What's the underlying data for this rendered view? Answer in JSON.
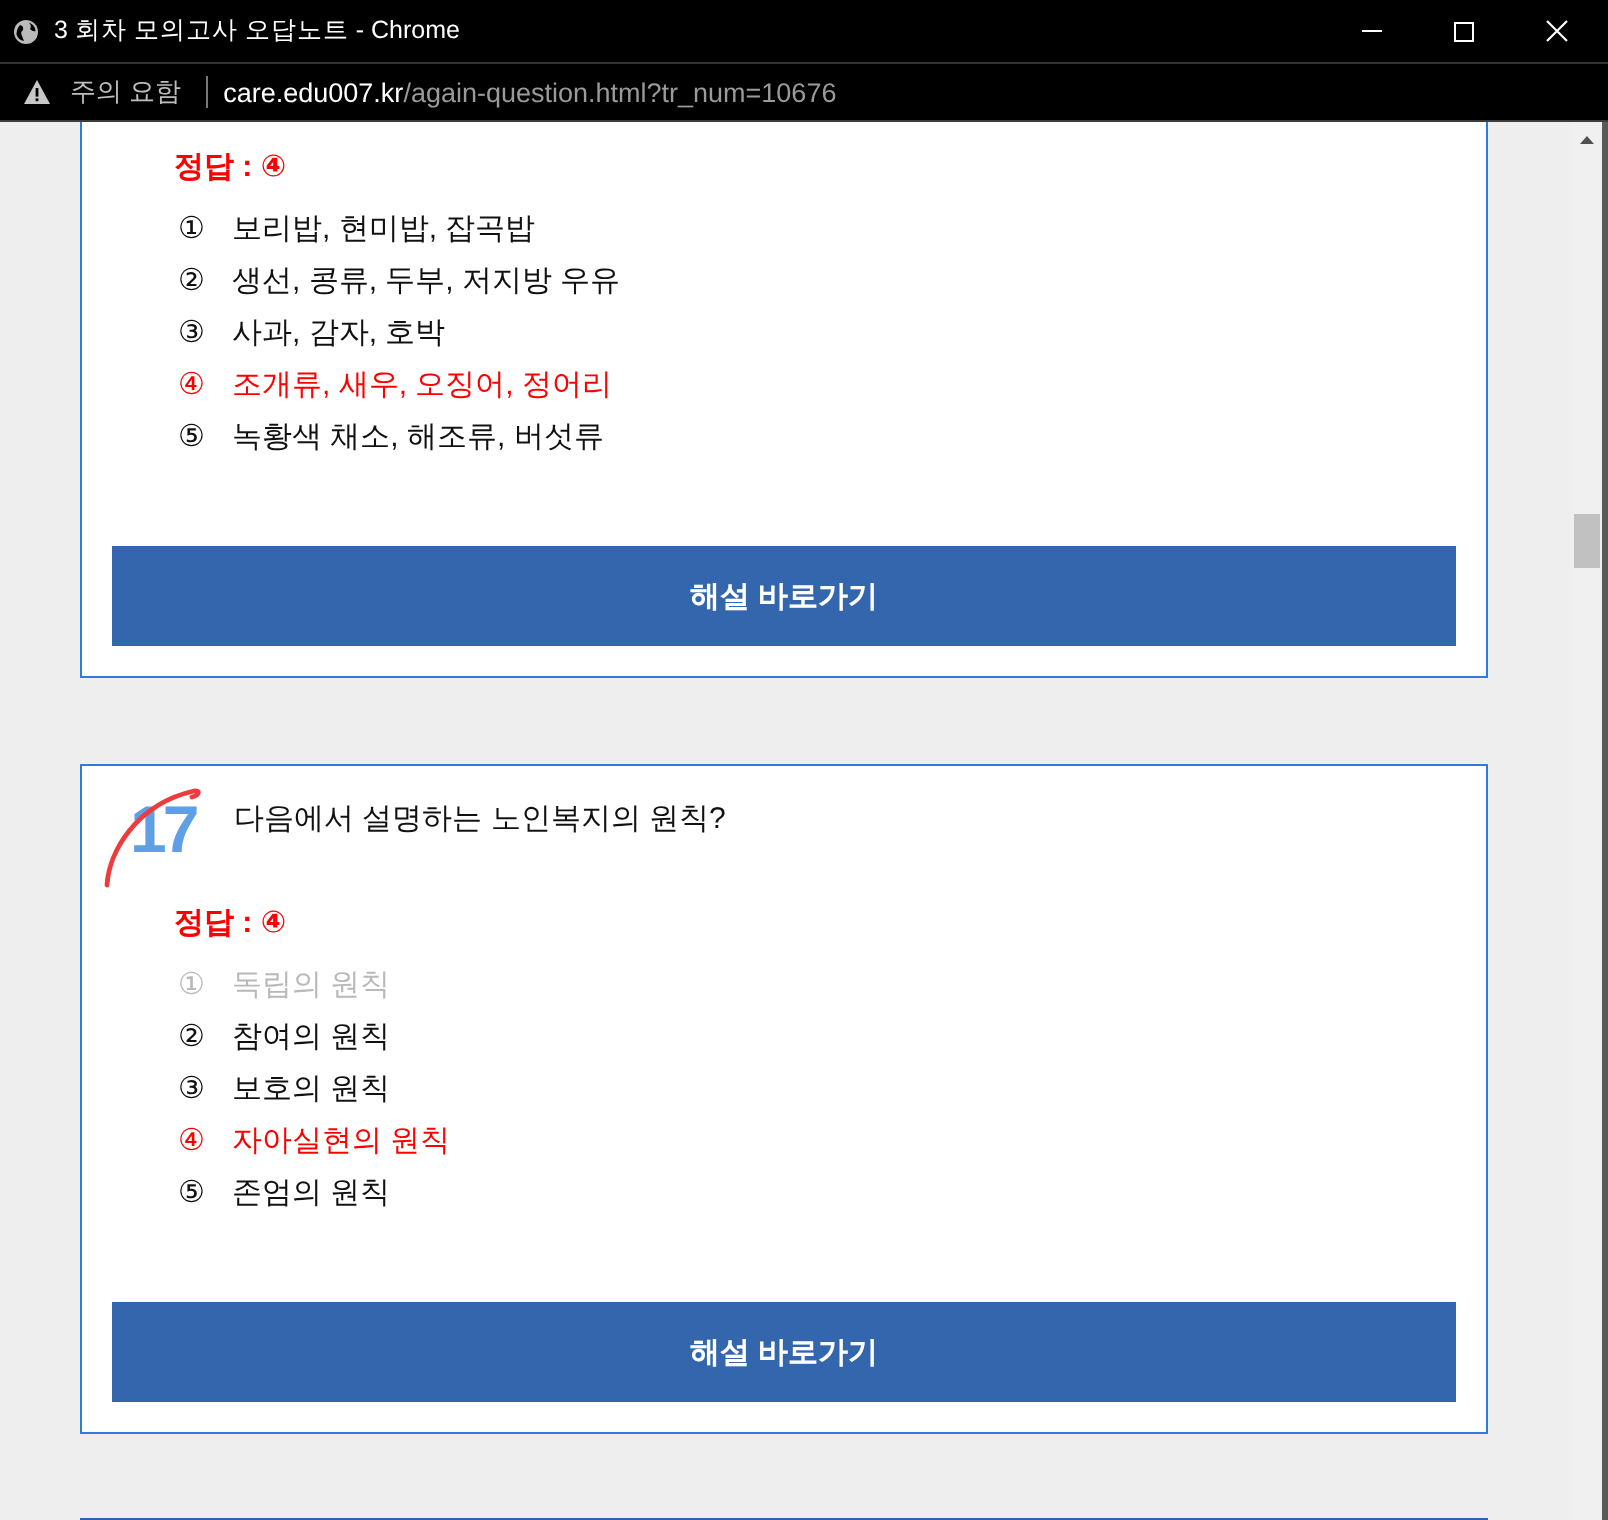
{
  "window": {
    "title": "3 회차 모의고사 오답노트 - Chrome"
  },
  "address_bar": {
    "security": "주의 요함",
    "host": "care.edu007.kr",
    "path": "/again-question.html?tr_num=10676"
  },
  "questions": [
    {
      "answer_label": "정답 : ④",
      "options": [
        {
          "marker": "①",
          "text": "보리밥, 현미밥, 잡곡밥",
          "correct": false,
          "dimmed": false
        },
        {
          "marker": "②",
          "text": "생선, 콩류, 두부, 저지방 우유",
          "correct": false,
          "dimmed": false
        },
        {
          "marker": "③",
          "text": "사과, 감자, 호박",
          "correct": false,
          "dimmed": false
        },
        {
          "marker": "④",
          "text": "조개류, 새우, 오징어, 정어리",
          "correct": true,
          "dimmed": false
        },
        {
          "marker": "⑤",
          "text": "녹황색 채소, 해조류, 버섯류",
          "correct": false,
          "dimmed": false
        }
      ],
      "button": "해설 바로가기"
    },
    {
      "number": "17",
      "question": "다음에서 설명하는 노인복지의 원칙?",
      "answer_label": "정답 : ④",
      "options": [
        {
          "marker": "①",
          "text": "독립의 원칙",
          "correct": false,
          "dimmed": true
        },
        {
          "marker": "②",
          "text": "참여의 원칙",
          "correct": false,
          "dimmed": false
        },
        {
          "marker": "③",
          "text": "보호의 원칙",
          "correct": false,
          "dimmed": false
        },
        {
          "marker": "④",
          "text": "자아실현의 원칙",
          "correct": true,
          "dimmed": false
        },
        {
          "marker": "⑤",
          "text": "존엄의 원칙",
          "correct": false,
          "dimmed": false
        }
      ],
      "button": "해설 바로가기"
    }
  ]
}
